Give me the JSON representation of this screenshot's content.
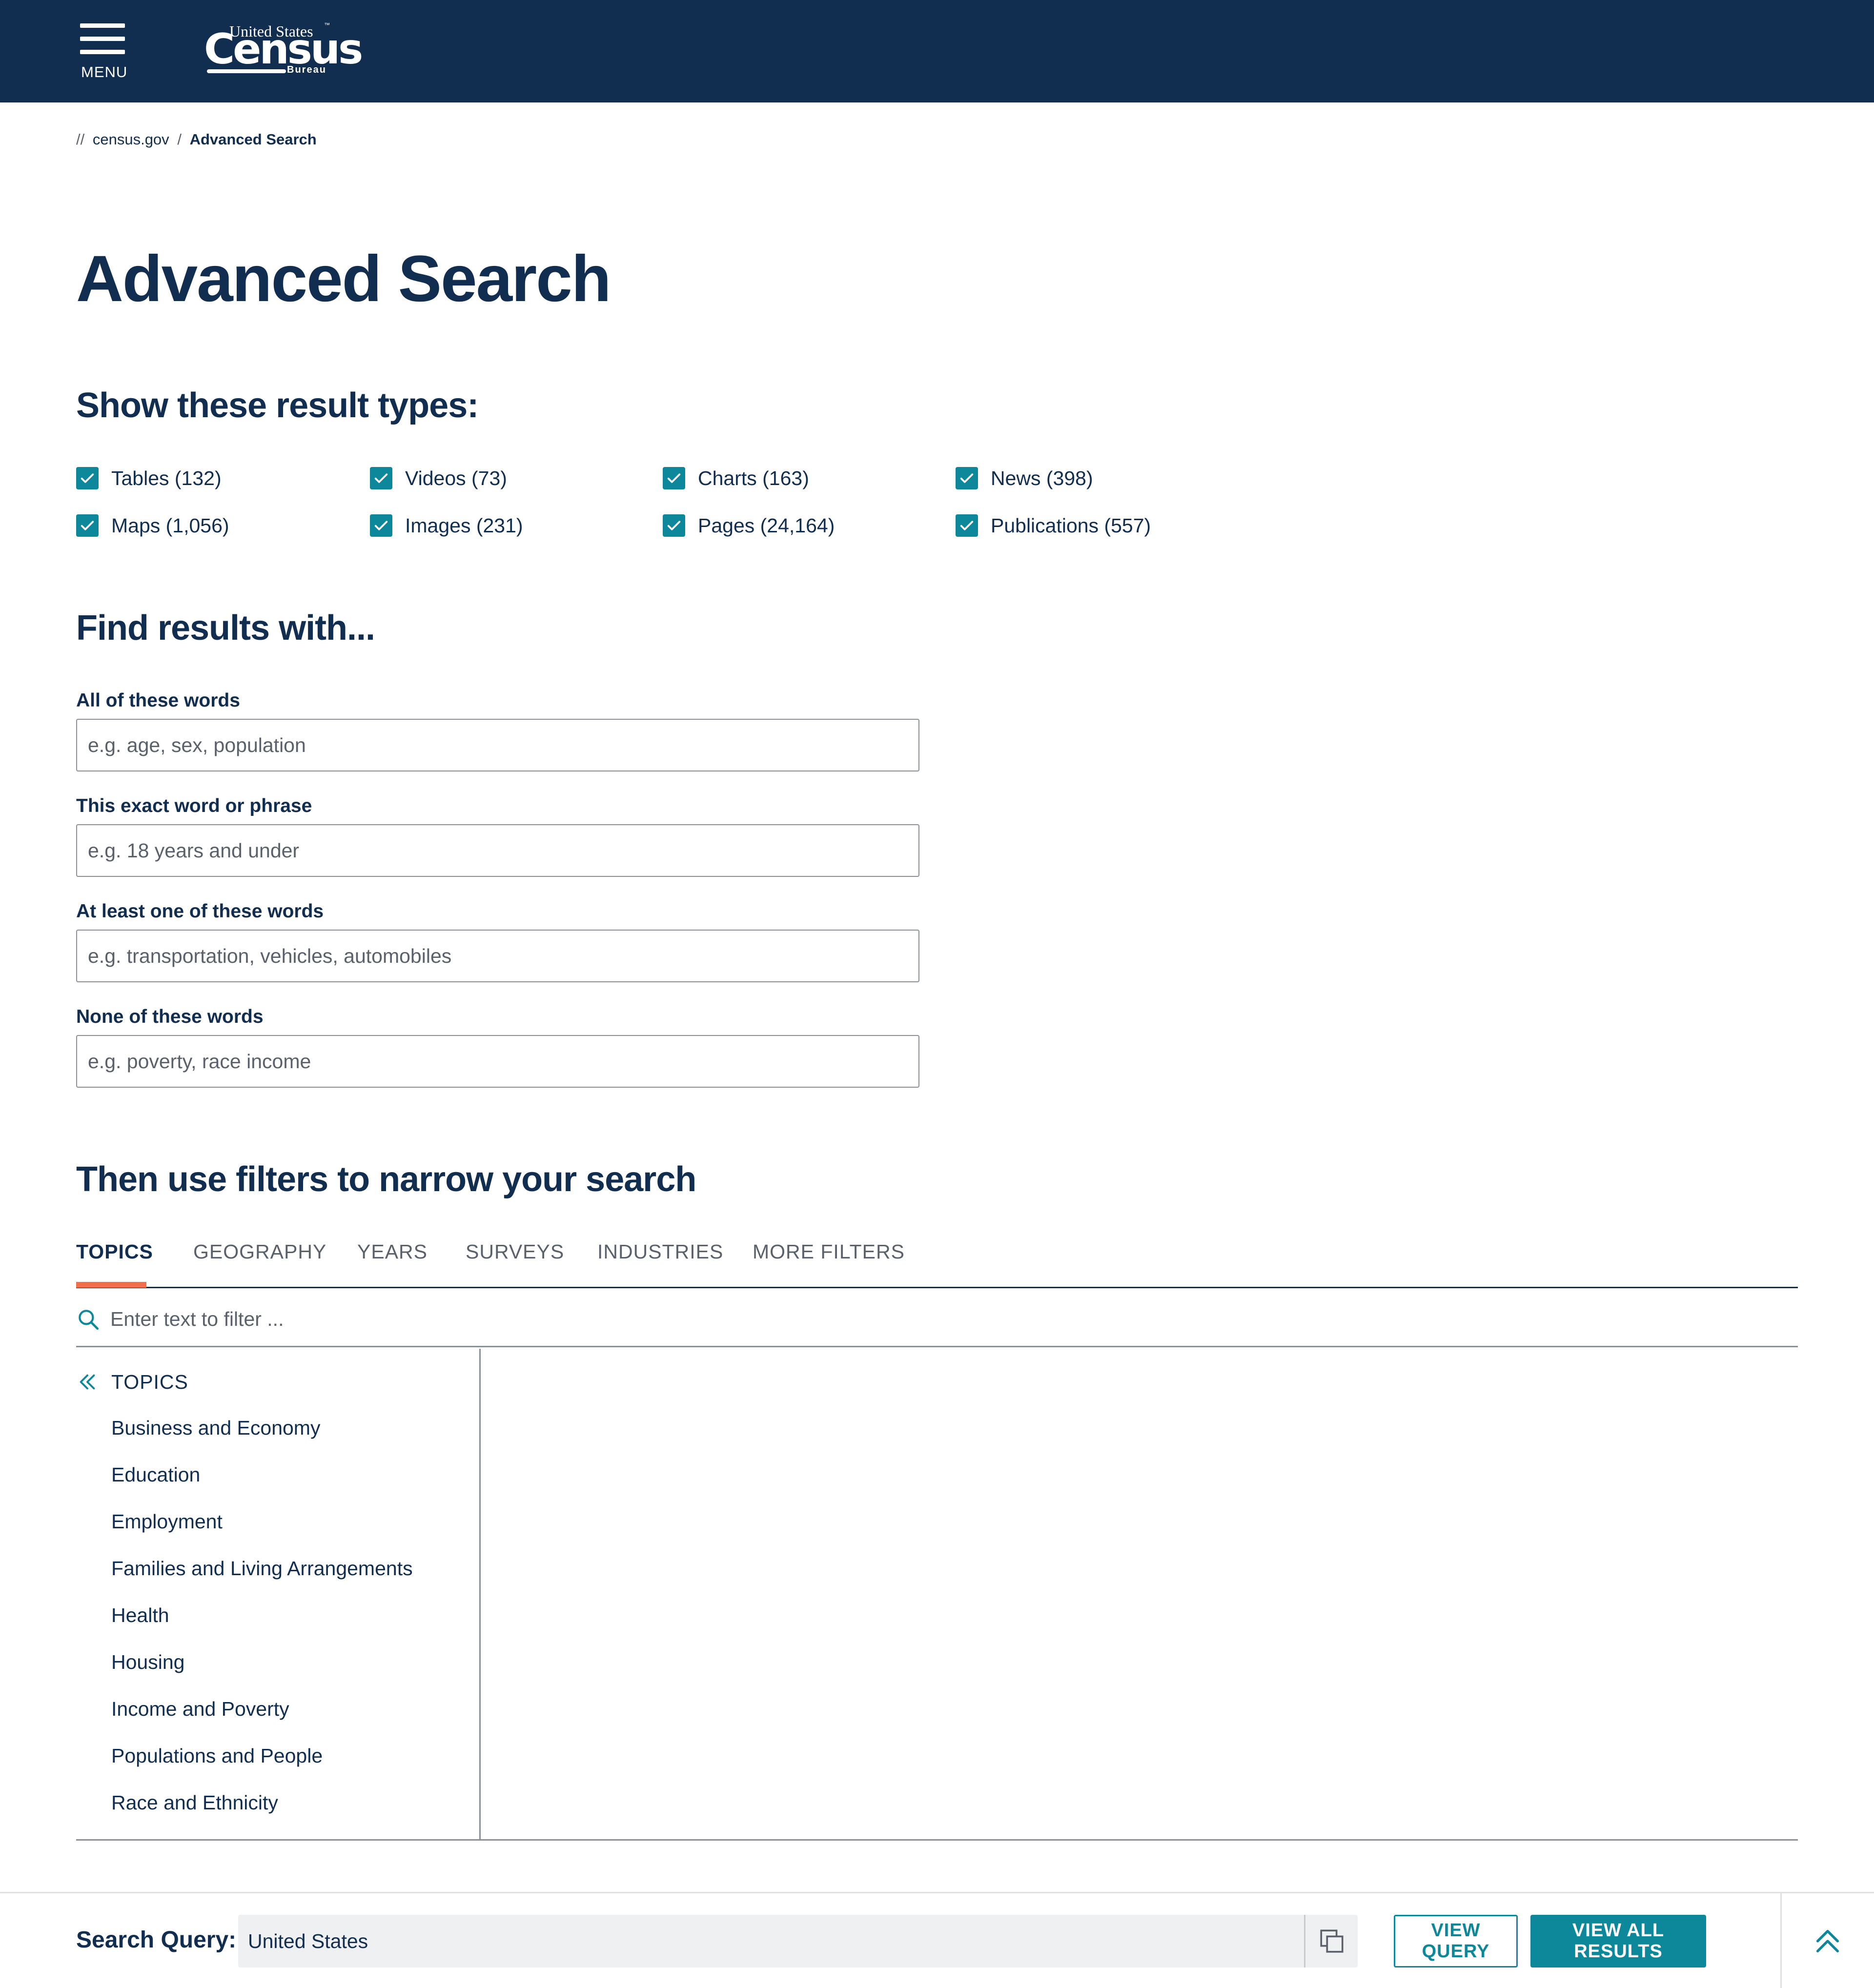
{
  "header": {
    "menu_label": "MENU",
    "logo": {
      "top": "United States",
      "main": "Census",
      "bureau": "Bureau",
      "tm": "™"
    }
  },
  "breadcrumb": {
    "marker": "//",
    "home": "census.gov",
    "separator": "/",
    "current": "Advanced Search"
  },
  "page_title": "Advanced Search",
  "result_types": {
    "heading": "Show these result types:",
    "items": [
      {
        "label": "Tables (132)",
        "checked": true
      },
      {
        "label": "Videos (73)",
        "checked": true
      },
      {
        "label": "Charts (163)",
        "checked": true
      },
      {
        "label": "News (398)",
        "checked": true
      },
      {
        "label": "Maps (1,056)",
        "checked": true
      },
      {
        "label": "Images (231)",
        "checked": true
      },
      {
        "label": "Pages (24,164)",
        "checked": true
      },
      {
        "label": "Publications (557)",
        "checked": true
      }
    ]
  },
  "find_results": {
    "heading": "Find results with...",
    "fields": [
      {
        "label": "All of these words",
        "placeholder": "e.g. age, sex, population",
        "value": ""
      },
      {
        "label": "This exact word or phrase",
        "placeholder": "e.g. 18 years and under",
        "value": ""
      },
      {
        "label": "At least one of these words",
        "placeholder": "e.g. transportation, vehicles, automobiles",
        "value": ""
      },
      {
        "label": "None of these words",
        "placeholder": "e.g. poverty, race income",
        "value": ""
      }
    ]
  },
  "filters": {
    "heading": "Then use filters to narrow your search",
    "tabs": [
      {
        "label": "TOPICS",
        "active": true
      },
      {
        "label": "GEOGRAPHY",
        "active": false
      },
      {
        "label": "YEARS",
        "active": false
      },
      {
        "label": "SURVEYS",
        "active": false
      },
      {
        "label": "INDUSTRIES",
        "active": false
      },
      {
        "label": "MORE FILTERS",
        "active": false
      }
    ],
    "filter_placeholder": "Enter text to filter ...",
    "topics_heading": "TOPICS",
    "topics": [
      "Business and Economy",
      "Education",
      "Employment",
      "Families and Living Arrangements",
      "Health",
      "Housing",
      "Income and Poverty",
      "Populations and People",
      "Race and Ethnicity"
    ]
  },
  "bottom_bar": {
    "search_query_label": "Search Query:",
    "search_query_value": "United States",
    "view_query_label": "VIEW QUERY",
    "view_all_label": "VIEW ALL RESULTS"
  },
  "colors": {
    "navy": "#112e51",
    "teal": "#0d879a",
    "orange": "#f26e4a",
    "gray_text": "#5b616b"
  }
}
